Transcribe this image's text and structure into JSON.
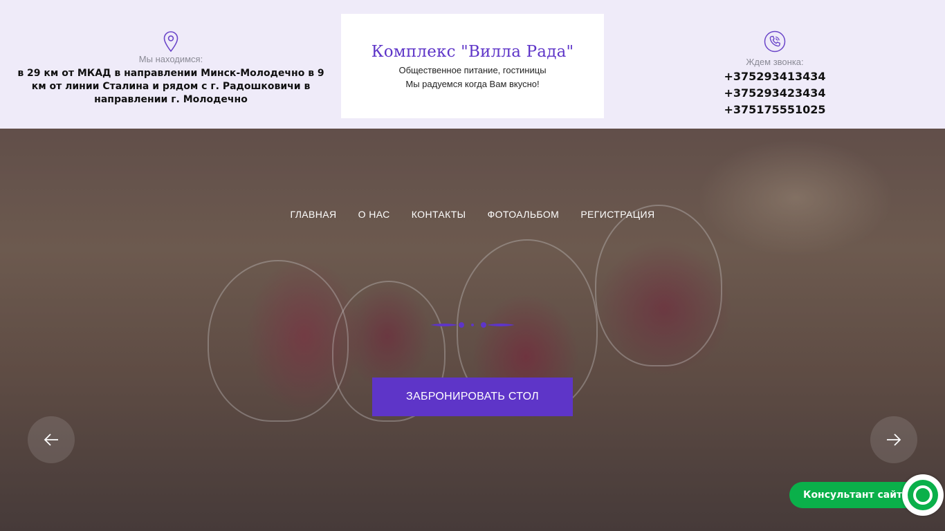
{
  "header": {
    "location": {
      "caption": "Мы находимся:",
      "address": "в 29 км от МКАД в направлении Минск-Молодечно в 9 км от линии Сталина и рядом с г. Радошковичи в направлении г. Молодечно",
      "icon": "map-pin-icon"
    },
    "brand": {
      "title": "Комплекс \"Вилла Рада\"",
      "subtitle": "Общественное питание, гостиницы",
      "tagline": "Мы радуемся когда Вам вкусно!"
    },
    "contacts": {
      "caption": "Ждем звонка:",
      "icon": "phone-icon",
      "phones": [
        "+375293413434",
        "+375293423434",
        "+375175551025"
      ]
    }
  },
  "nav": {
    "items": [
      "ГЛАВНАЯ",
      "О НАС",
      "КОНТАКТЫ",
      "ФОТОАЛЬБОМ",
      "РЕГИСТРАЦИЯ"
    ]
  },
  "hero": {
    "cta_label": "ЗАБРОНИРОВАТЬ СТОЛ",
    "prev_icon": "arrow-left-icon",
    "next_icon": "arrow-right-icon"
  },
  "widget": {
    "label": "Консультант сайта"
  },
  "colors": {
    "accent": "#5e35c8",
    "widget_green": "#0ab04a",
    "topbar_bg": "#efebf9"
  }
}
